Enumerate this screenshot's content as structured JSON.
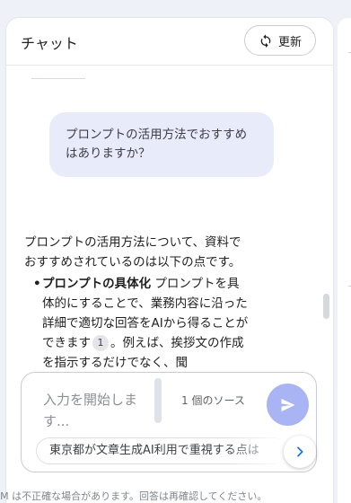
{
  "header": {
    "title": "チャット",
    "refresh_label": "更新"
  },
  "user_message": "プロンプトの活用方法でおすすめはありますか？",
  "answer": {
    "intro": "プロンプトの活用方法について、資料でおすすめされているのは以下の点です。",
    "items": [
      {
        "bold": "プロンプトの具体化",
        "text": " プロンプトを具体的にすることで、業務内容に沿った詳細で適切な回答をAIから得ることができます",
        "citation": "1",
        "after": "。例えば、挨拶文の作成を指示するだけでなく、聞"
      }
    ]
  },
  "composer": {
    "placeholder": "入力を開始します...",
    "source_count": "1 個のソース",
    "suggestion": "東京都が文章生成AI利用で重視する点は"
  },
  "disclaimer": "LM は不正確な場合があります。回答は再確認してください。",
  "colors": {
    "user_bubble": "#e8ebfa",
    "send_button": "#a9b4f5",
    "next_arrow": "#1a73e8"
  }
}
